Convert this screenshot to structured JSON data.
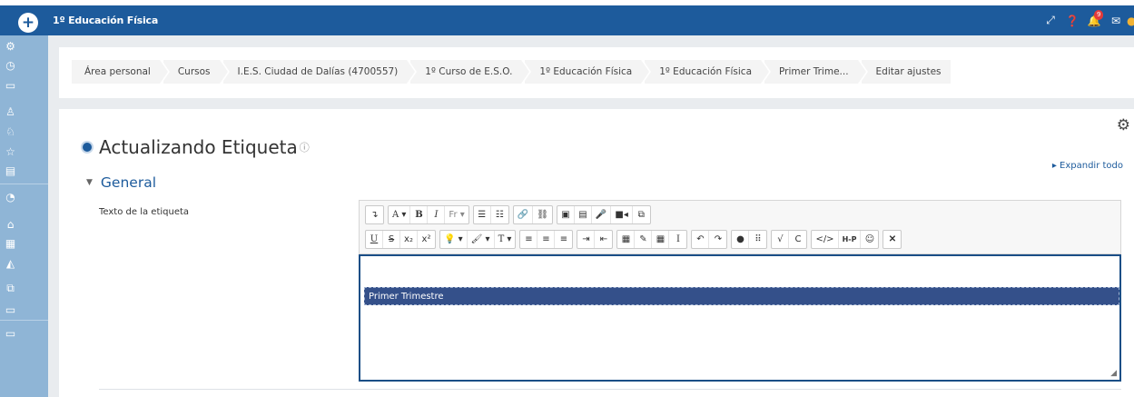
{
  "navbar": {
    "course_title": "1º Educación Física",
    "notifications_count": "9",
    "icons": [
      "expand-icon",
      "help-icon",
      "bell-icon",
      "mail-icon"
    ]
  },
  "sidebar": {
    "icons": [
      "cogs-icon",
      "clock-icon",
      "folder-icon",
      "users-icon",
      "badge-icon",
      "star-icon",
      "book-icon",
      "dashboard-icon",
      "home-icon",
      "calendar-icon",
      "graduation-icon",
      "files-icon",
      "folder-icon",
      "folder-icon"
    ]
  },
  "breadcrumb": [
    "Área personal",
    "Cursos",
    "I.E.S. Ciudad de Dalías (4700557)",
    "1º Curso de E.S.O.",
    "1º Educación Física",
    "1º Educación Física",
    "Primer Trime...",
    "Editar ajustes"
  ],
  "page": {
    "title": "Actualizando Etiqueta",
    "help": "ⓘ",
    "expand_all": "Expandir todo",
    "section": "General",
    "field_label": "Texto de la etiqueta"
  },
  "editor": {
    "content_text": "Primer Trimestre",
    "toolbar_row1": [
      "↴",
      "A ▾",
      "B",
      "I",
      "Fr ▾",
      "☰",
      "☷",
      "🔗",
      "⛓",
      "▣",
      "▤",
      "🎤",
      "■◂",
      "⧉"
    ],
    "toolbar_row2": [
      "U",
      "S",
      "x₂",
      "x²",
      "💡 ▾",
      "🖌 ▾",
      "T ▾",
      "≡",
      "≡",
      "≡",
      "⇥",
      "⇤",
      "▦",
      "✎",
      "▦",
      "I",
      "↶",
      "↷",
      "●",
      "⠿",
      "√",
      "C",
      "</>",
      "H-P",
      "☺",
      "✕"
    ]
  },
  "colors": {
    "navbar": "#1d5b9c",
    "sidebar": "#8fb5d6",
    "accent": "#1d5b9c",
    "selection": "#34508a"
  }
}
